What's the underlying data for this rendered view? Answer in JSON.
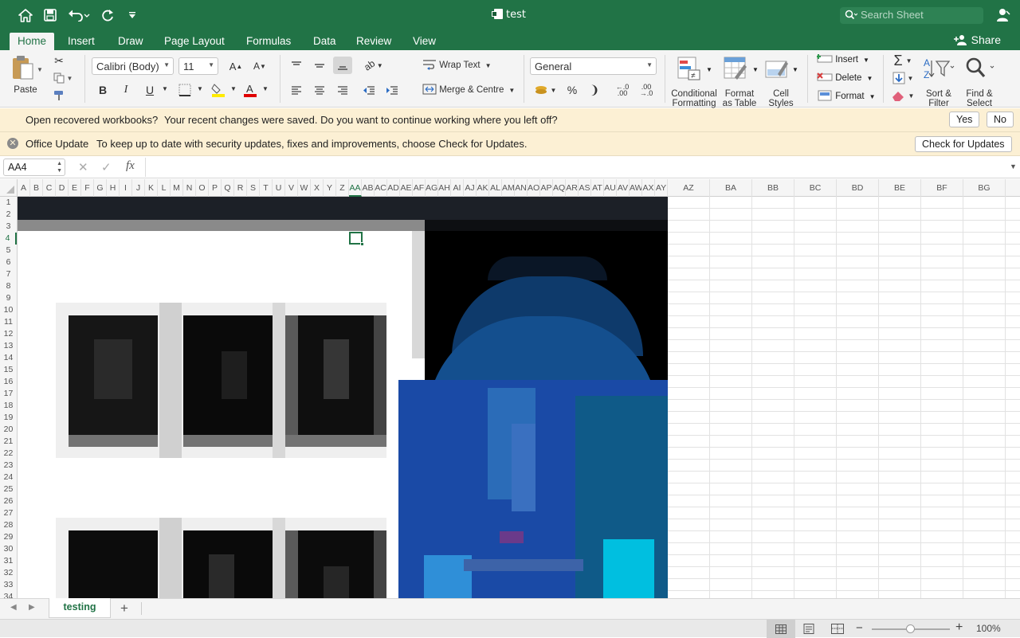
{
  "window": {
    "title": "test",
    "search_placeholder": "Search Sheet"
  },
  "tabs": [
    {
      "label": "Home",
      "active": true
    },
    {
      "label": "Insert"
    },
    {
      "label": "Draw"
    },
    {
      "label": "Page Layout"
    },
    {
      "label": "Formulas"
    },
    {
      "label": "Data"
    },
    {
      "label": "Review"
    },
    {
      "label": "View"
    }
  ],
  "share_label": "Share",
  "ribbon": {
    "paste": "Paste",
    "font_name": "Calibri (Body)",
    "font_size": "11",
    "wrap_text": "Wrap Text",
    "merge_centre": "Merge & Centre",
    "number_format": "General",
    "conditional_formatting": "Conditional\nFormatting",
    "format_as_table": "Format\nas Table",
    "cell_styles": "Cell\nStyles",
    "insert": "Insert",
    "delete": "Delete",
    "format": "Format",
    "sort_filter": "Sort &\nFilter",
    "find_select": "Find &\nSelect"
  },
  "recover_bar": {
    "title": "Open recovered workbooks?",
    "message": "Your recent changes were saved. Do you want to continue working where you left off?",
    "yes": "Yes",
    "no": "No"
  },
  "update_bar": {
    "title": "Office Update",
    "message": "To keep up to date with security updates, fixes and improvements, choose Check for Updates.",
    "button": "Check for Updates"
  },
  "formula_bar": {
    "name_box": "AA4",
    "fx": "fx",
    "value": ""
  },
  "columns": [
    "A",
    "B",
    "C",
    "D",
    "E",
    "F",
    "G",
    "H",
    "I",
    "J",
    "K",
    "L",
    "M",
    "N",
    "O",
    "P",
    "Q",
    "R",
    "S",
    "T",
    "U",
    "V",
    "W",
    "X",
    "Y",
    "Z",
    "AA",
    "AB",
    "AC",
    "AD",
    "AE",
    "AF",
    "AG",
    "AH",
    "AI",
    "AJ",
    "AK",
    "AL",
    "AM",
    "AN",
    "AO",
    "AP",
    "AQ",
    "AR",
    "AS",
    "AT",
    "AU",
    "AV",
    "AW",
    "AX",
    "AY",
    "AZ",
    "BA",
    "BB",
    "BC",
    "BD",
    "BE",
    "BF",
    "BG"
  ],
  "selected_column": "AA",
  "rows": [
    "1",
    "2",
    "3",
    "4",
    "5",
    "6",
    "7",
    "8",
    "9",
    "10",
    "11",
    "12",
    "13",
    "14",
    "15",
    "16",
    "17",
    "18",
    "19",
    "20",
    "21",
    "22",
    "23",
    "24",
    "25",
    "26",
    "27",
    "28",
    "29",
    "30",
    "31",
    "32",
    "33",
    "34"
  ],
  "selected_row": "4",
  "sheet_tabs": [
    {
      "label": "testing",
      "active": true
    }
  ],
  "zoom": "100%",
  "colors": {
    "accent": "#217346",
    "ribbon_bg": "#f4f4f4",
    "notice_bg": "#fcf0d4"
  }
}
